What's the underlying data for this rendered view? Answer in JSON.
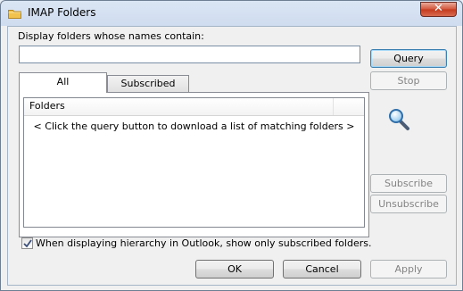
{
  "window": {
    "title": "IMAP Folders",
    "close_symbol": "✕"
  },
  "query": {
    "label": "Display folders whose names contain:",
    "value": "",
    "query_button": "Query",
    "stop_button": "Stop"
  },
  "tabs": [
    {
      "label": "All",
      "active": true
    },
    {
      "label": "Subscribed",
      "active": false
    }
  ],
  "folder_list": {
    "column_header": "Folders",
    "message": "< Click the query button to download a list of matching folders >"
  },
  "side_buttons": {
    "subscribe": "Subscribe",
    "unsubscribe": "Unsubscribe"
  },
  "option": {
    "checked": true,
    "label": "When displaying hierarchy in Outlook, show only subscribed folders."
  },
  "footer": {
    "ok": "OK",
    "cancel": "Cancel",
    "apply": "Apply"
  },
  "icons": {
    "title": "folder-icon",
    "search": "magnifier-icon",
    "check": "checkmark-icon"
  }
}
